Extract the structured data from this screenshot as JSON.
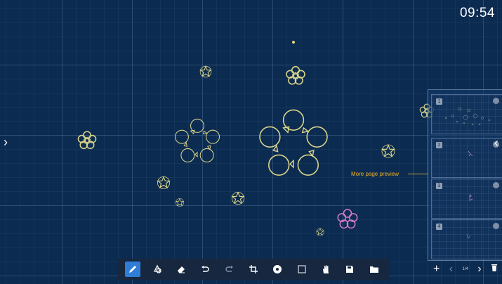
{
  "status": {
    "clock": "09:54"
  },
  "preview_panel": {
    "callout": "More page preview",
    "pages": [
      {
        "number": "1"
      },
      {
        "number": "2"
      },
      {
        "number": "3"
      },
      {
        "number": "4"
      }
    ]
  },
  "toolbar": {
    "tools": [
      {
        "name": "pen",
        "icon": "pen-icon",
        "active": true
      },
      {
        "name": "shape-recognition",
        "icon": "shape-icon",
        "active": false
      },
      {
        "name": "eraser",
        "icon": "eraser-icon",
        "active": false
      },
      {
        "name": "undo",
        "icon": "undo-icon",
        "active": false
      },
      {
        "name": "redo",
        "icon": "redo-icon",
        "active": false
      },
      {
        "name": "crop",
        "icon": "crop-icon",
        "active": false
      },
      {
        "name": "more",
        "icon": "more-circle-icon",
        "active": false
      },
      {
        "name": "select",
        "icon": "select-box-icon",
        "active": false
      },
      {
        "name": "hand-roam",
        "icon": "hand-icon",
        "active": false
      },
      {
        "name": "save",
        "icon": "save-icon",
        "active": false
      },
      {
        "name": "open-folder",
        "icon": "folder-icon",
        "active": false
      }
    ]
  },
  "page_nav": {
    "indicator": "1/4",
    "add": "+",
    "prev": "‹",
    "next": "›"
  },
  "colors": {
    "background": "#0c2b50",
    "ink": "#d8d48a",
    "ink_pink": "#d57ac8",
    "accent": "#2f7dd6",
    "callout": "#f2b321"
  }
}
